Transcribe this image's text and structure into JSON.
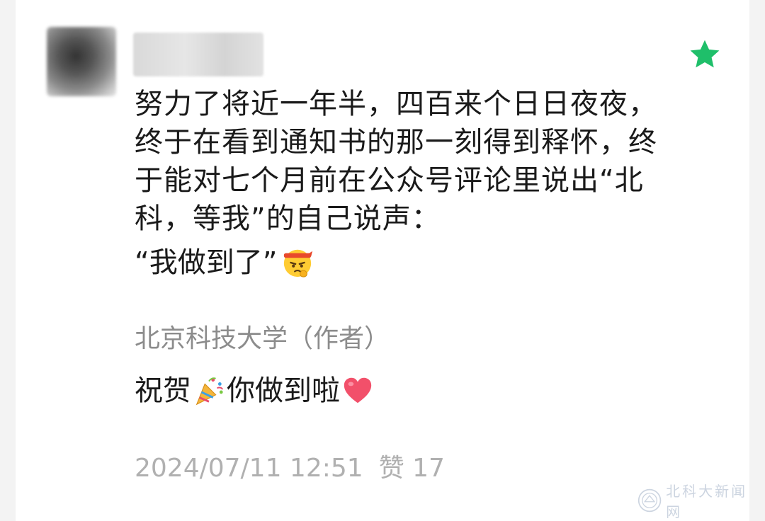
{
  "comment": {
    "text": "努力了将近一年半，四百来个日日夜夜，终于在看到通知书的那一刻得到释怀，终于能对七个月前在公众号评论里说出“北科，等我”的自己说声：",
    "quote": "“我做到了”",
    "quote_emoji": "determined-face-emoji",
    "starred": true,
    "star_color": "#1fbf6a"
  },
  "reply": {
    "author": "北京科技大学（作者）",
    "text_before": "祝贺",
    "emoji_1": "party-popper-emoji",
    "text_after": "你做到啦",
    "emoji_2": "heart-emoji",
    "heart_color": "#f2506a"
  },
  "meta": {
    "timestamp": "2024/07/11 12:51",
    "likes_label": "赞 17"
  },
  "watermark": {
    "text": "北科大新闻网"
  }
}
